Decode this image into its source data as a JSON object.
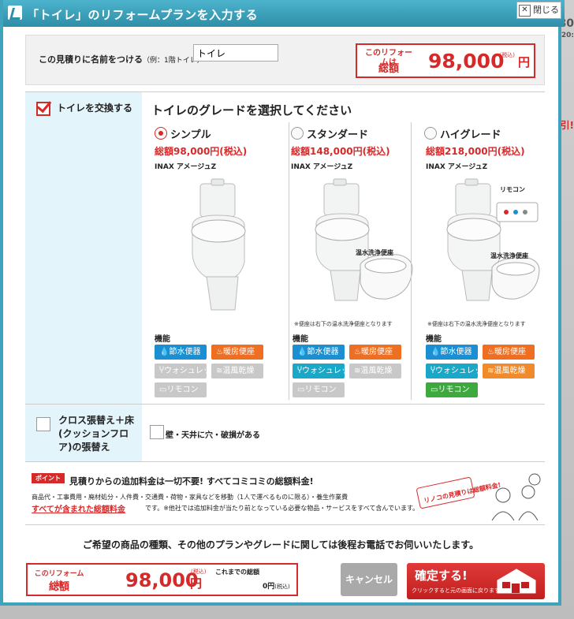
{
  "backdrop": {
    "text_top": "80",
    "text_second": "20:",
    "text_mid": "引!"
  },
  "dialog": {
    "title": "「トイレ」のリフォームプランを入力する",
    "close_label": "閉じる"
  },
  "name_section": {
    "label": "この見積りに名前をつける",
    "example": "（例：1階トイレ）",
    "input_value": "トイレ"
  },
  "total_top": {
    "label_small": "このリフォームは",
    "label_big": "総額",
    "value": "98,000",
    "tax": "(税込)",
    "unit": "円"
  },
  "toilet_section": {
    "checkbox_label": "トイレを交換する",
    "checked": true,
    "heading": "トイレのグレードを選択してください",
    "feature_heading": "機能",
    "grades": [
      {
        "name": "シンプル",
        "selected": true,
        "price": "総額98,000円(税込)",
        "brand": "INAX アメージュZ",
        "features": [
          {
            "label": "節水便器",
            "icon": "droplet-icon",
            "color": "#1b8fd1",
            "enabled": true
          },
          {
            "label": "暖房便座",
            "icon": "heat-icon",
            "color": "#ee6e22",
            "enabled": true
          },
          {
            "label": "ウォシュレット",
            "icon": "washlet-icon",
            "color": "#c8c8c8",
            "enabled": false
          },
          {
            "label": "温風乾燥",
            "icon": "airflow-icon",
            "color": "#c8c8c8",
            "enabled": false
          },
          {
            "label": "リモコン",
            "icon": "remote-icon",
            "color": "#c8c8c8",
            "enabled": false
          }
        ]
      },
      {
        "name": "スタンダード",
        "selected": false,
        "price": "総額148,000円(税込)",
        "brand": "INAX アメージュZ",
        "seat_label": "温水洗浄便座",
        "note": "※便座は右下の温水洗浄便座となります",
        "features": [
          {
            "label": "節水便器",
            "icon": "droplet-icon",
            "color": "#1b8fd1",
            "enabled": true
          },
          {
            "label": "暖房便座",
            "icon": "heat-icon",
            "color": "#ee6e22",
            "enabled": true
          },
          {
            "label": "ウォシュレット",
            "icon": "washlet-icon",
            "color": "#19a8c8",
            "enabled": true
          },
          {
            "label": "温風乾燥",
            "icon": "airflow-icon",
            "color": "#c8c8c8",
            "enabled": false
          },
          {
            "label": "リモコン",
            "icon": "remote-icon",
            "color": "#c8c8c8",
            "enabled": false
          }
        ]
      },
      {
        "name": "ハイグレード",
        "selected": false,
        "price": "総額218,000円(税込)",
        "brand": "INAX アメージュZ",
        "seat_label": "温水洗浄便座",
        "remote_label": "リモコン",
        "note": "※便座は右下の温水洗浄便座となります",
        "features": [
          {
            "label": "節水便器",
            "icon": "droplet-icon",
            "color": "#1b8fd1",
            "enabled": true
          },
          {
            "label": "暖房便座",
            "icon": "heat-icon",
            "color": "#ee6e22",
            "enabled": true
          },
          {
            "label": "ウォシュレット",
            "icon": "washlet-icon",
            "color": "#19a8c8",
            "enabled": true
          },
          {
            "label": "温風乾燥",
            "icon": "airflow-icon",
            "color": "#f08a2a",
            "enabled": true
          },
          {
            "label": "リモコン",
            "icon": "remote-icon",
            "color": "#3daa3d",
            "enabled": true
          }
        ]
      }
    ]
  },
  "floor_section": {
    "checkbox_label": "クロス張替え＋床(クッションフロア)の張替え",
    "checked": false,
    "option_label": "壁・天井に穴・破損がある"
  },
  "point": {
    "tag": "ポイント",
    "headline": "見積りからの追加料金は一切不要! すべてコミコミの総額料金!",
    "sub": "商品代・工事費用・廃材処分・人件費・交通費・荷物・家具などを移動（1人で運べるものに限る）・養生作業費",
    "all_included": "すべてが含まれた総額料金",
    "note": "です。※他社では追加料金が当たり前となっている必要な物品・サービスをすべて含んでいます。",
    "illus_label": "リノコの見積りは総額料金!"
  },
  "contact_text": "ご希望の商品の種類、その他のプランやグレードに関しては後程お電話でお伺いいたします。",
  "total_bottom": {
    "label_small": "このリフォームは",
    "label_big": "総額",
    "value": "98,000",
    "tax": "(税込)",
    "unit": "円",
    "prev_label": "これまでの総額",
    "prev_value": "0",
    "prev_unit": "円",
    "prev_tax": "(税込)"
  },
  "buttons": {
    "cancel": "キャンセル",
    "confirm": "確定する!",
    "confirm_sub": "クリックすると元の画面に戻ります"
  }
}
